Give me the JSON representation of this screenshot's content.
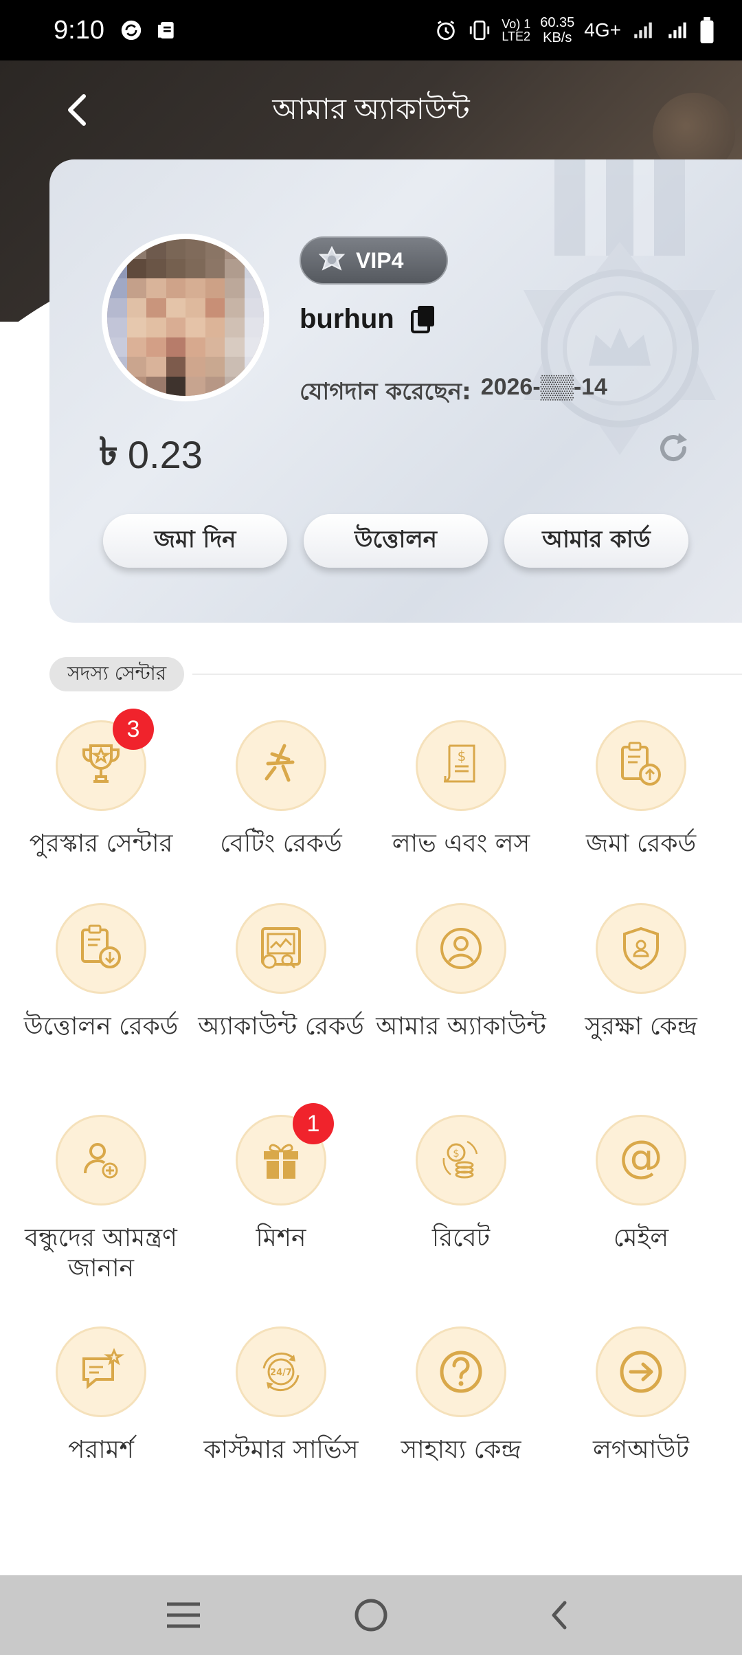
{
  "status_bar": {
    "time": "9:10",
    "volte_top": "Vo) 1",
    "volte_bottom": "LTE2",
    "speed_top": "60.35",
    "speed_bottom": "KB/s",
    "network": "4G+"
  },
  "header": {
    "title": "আমার অ্যাকাউন্ট"
  },
  "profile": {
    "vip": "VIP4",
    "username": "burhun",
    "joined_label": "যোগদান করেছেন:",
    "joined_date": "2026-▒▒-14",
    "currency_symbol": "৳",
    "balance": "0.23",
    "buttons": {
      "deposit": "জমা দিন",
      "withdraw": "উত্তোলন",
      "my_card": "আমার কার্ড"
    }
  },
  "member_center": {
    "title": "সদস্য সেন্টার",
    "items": [
      {
        "label": "পুরস্কার সেন্টার",
        "icon": "trophy-icon",
        "badge": "3"
      },
      {
        "label": "বেটিং রেকর্ড",
        "icon": "betting-icon"
      },
      {
        "label": "লাভ এবং লস",
        "icon": "bill-dollar-icon"
      },
      {
        "label": "জমা রেকর্ড",
        "icon": "clipboard-upload-icon"
      },
      {
        "label": "উত্তোলন রেকর্ড",
        "icon": "clipboard-download-icon"
      },
      {
        "label": "অ্যাকাউন্ট রেকর্ড",
        "icon": "account-record-icon"
      },
      {
        "label": "আমার অ্যাকাউন্ট",
        "icon": "user-circle-icon"
      },
      {
        "label": "সুরক্ষা কেন্দ্র",
        "icon": "shield-user-icon"
      },
      {
        "label": "বন্ধুদের আমন্ত্রণ জানান",
        "icon": "invite-user-icon"
      },
      {
        "label": "মিশন",
        "icon": "gift-icon",
        "badge": "1"
      },
      {
        "label": "রিবেট",
        "icon": "coins-icon"
      },
      {
        "label": "মেইল",
        "icon": "at-icon"
      },
      {
        "label": "পরামর্শ",
        "icon": "feedback-icon"
      },
      {
        "label": "কাস্টমার সার্ভিস",
        "icon": "support-247-icon"
      },
      {
        "label": "সাহায্য কেন্দ্র",
        "icon": "help-icon"
      },
      {
        "label": "লগআউট",
        "icon": "logout-icon"
      }
    ]
  },
  "colors": {
    "accent_gold": "#d9a84a",
    "icon_bg": "#fdf0d8",
    "badge_red": "#f0232c",
    "header_dark": "#2b2724"
  }
}
